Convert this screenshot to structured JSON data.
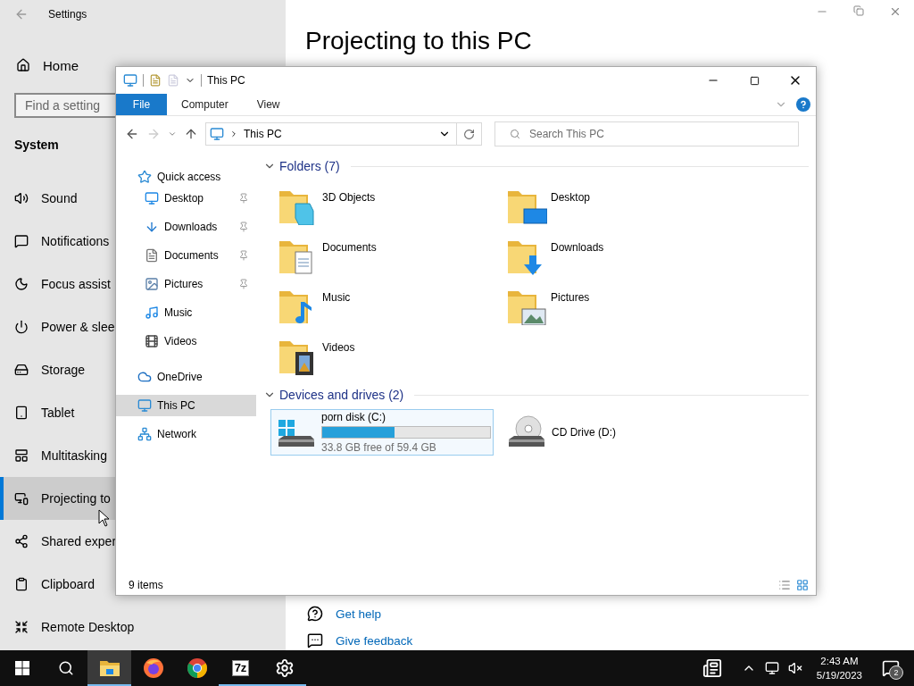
{
  "settings": {
    "title": "Settings",
    "home": "Home",
    "search": {
      "placeholder": "Find a setting"
    },
    "section": "System",
    "nav": [
      {
        "label": "Sound",
        "kind": "sound",
        "selected": false
      },
      {
        "label": "Notifications",
        "kind": "notifications",
        "selected": false
      },
      {
        "label": "Focus assist",
        "kind": "focus",
        "selected": false
      },
      {
        "label": "Power & slee",
        "kind": "power",
        "selected": false
      },
      {
        "label": "Storage",
        "kind": "storage",
        "selected": false
      },
      {
        "label": "Tablet",
        "kind": "tablet",
        "selected": false
      },
      {
        "label": "Multitasking",
        "kind": "multitasking",
        "selected": false
      },
      {
        "label": "Projecting to",
        "kind": "projecting",
        "selected": true
      },
      {
        "label": "Shared exper",
        "kind": "shared",
        "selected": false
      },
      {
        "label": "Clipboard",
        "kind": "clipboard",
        "selected": false
      },
      {
        "label": "Remote Desktop",
        "kind": "remote",
        "selected": false
      }
    ],
    "heading": "Projecting to this PC",
    "links": [
      {
        "label": "Get help",
        "kind": "help"
      },
      {
        "label": "Give feedback",
        "kind": "feedback"
      }
    ]
  },
  "explorer": {
    "title": "This PC",
    "ribbon_tabs": [
      {
        "label": "File",
        "selected": true
      },
      {
        "label": "Computer",
        "selected": false
      },
      {
        "label": "View",
        "selected": false
      }
    ],
    "address": "This PC",
    "search": {
      "placeholder": "Search This PC"
    },
    "nav_pane": [
      {
        "label": "Quick access",
        "kind": "star",
        "selected": false,
        "children": [
          {
            "label": "Desktop",
            "kind": "desktop",
            "pinned": true,
            "selected": false
          },
          {
            "label": "Downloads",
            "kind": "downloads",
            "pinned": true,
            "selected": false
          },
          {
            "label": "Documents",
            "kind": "documents",
            "pinned": true,
            "selected": false
          },
          {
            "label": "Pictures",
            "kind": "pictures",
            "pinned": true,
            "selected": false
          },
          {
            "label": "Music",
            "kind": "music",
            "pinned": false,
            "selected": false
          },
          {
            "label": "Videos",
            "kind": "videos",
            "pinned": false,
            "selected": false
          }
        ]
      },
      {
        "label": "OneDrive",
        "kind": "cloud",
        "selected": false
      },
      {
        "label": "This PC",
        "kind": "pc",
        "selected": true
      },
      {
        "label": "Network",
        "kind": "network",
        "selected": false
      }
    ],
    "folders": {
      "title": "Folders (7)",
      "expanded": true,
      "items": [
        {
          "label": "3D Objects",
          "kind": "objects"
        },
        {
          "label": "Desktop",
          "kind": "desktop"
        },
        {
          "label": "Documents",
          "kind": "documents"
        },
        {
          "label": "Downloads",
          "kind": "downloads"
        },
        {
          "label": "Music",
          "kind": "music"
        },
        {
          "label": "Pictures",
          "kind": "pictures"
        },
        {
          "label": "Videos",
          "kind": "videos"
        }
      ]
    },
    "drives": {
      "title": "Devices and drives (2)",
      "expanded": true,
      "items": [
        {
          "label": "porn disk (C:)",
          "kind": "system",
          "selected": true,
          "level": 0.43,
          "reading": "33.8 GB free of 59.4 GB"
        },
        {
          "label": "CD Drive (D:)",
          "kind": "cd",
          "selected": false
        }
      ]
    },
    "status": "9 items"
  },
  "taskbar": {
    "apps": [
      {
        "kind": "explorer",
        "active": true,
        "running": true
      },
      {
        "kind": "firefox",
        "active": false,
        "running": false
      },
      {
        "kind": "chrome",
        "active": false,
        "running": false
      },
      {
        "kind": "archiver",
        "label": "7z",
        "active": false,
        "running": true
      },
      {
        "kind": "settings",
        "active": false,
        "running": true
      }
    ],
    "time": "2:43 AM",
    "date": "5/19/2023",
    "notifications": "2"
  }
}
